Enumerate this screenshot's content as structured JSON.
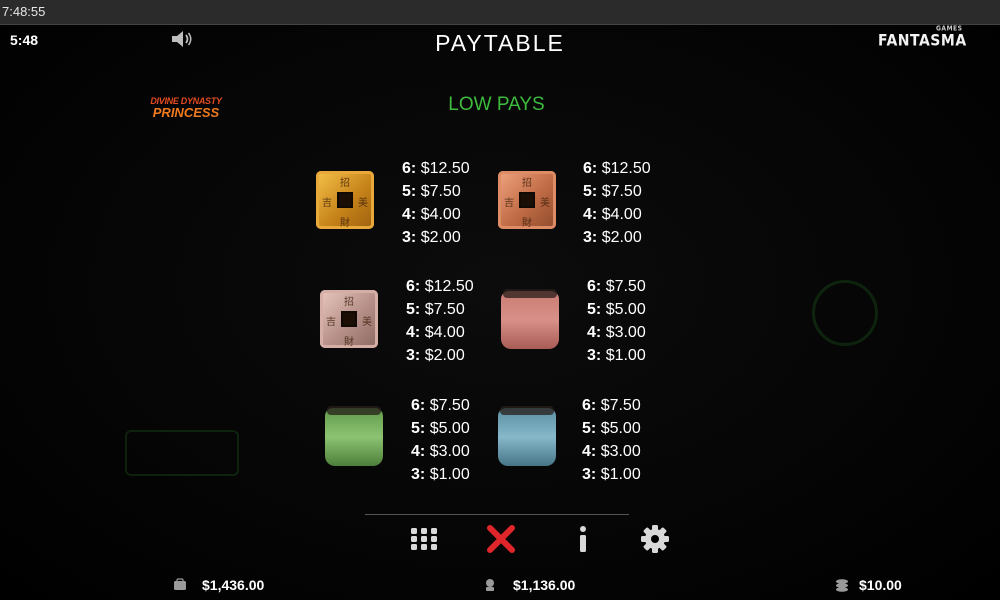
{
  "system_bar": {
    "clock": "7:48:55"
  },
  "header": {
    "game_time": "5:48",
    "title": "PAYTABLE",
    "brand": "FANTASMA",
    "brand_sub": "GAMES"
  },
  "game_logo": {
    "line1": "DIVINE DYNASTY",
    "line2": "PRINCESS"
  },
  "section_title": "LOW PAYS",
  "paytable": [
    {
      "symbol": "gold-coin-icon",
      "pays": [
        {
          "count": "6:",
          "amount": "$12.50"
        },
        {
          "count": "5:",
          "amount": "$7.50"
        },
        {
          "count": "4:",
          "amount": "$4.00"
        },
        {
          "count": "3:",
          "amount": "$2.00"
        }
      ]
    },
    {
      "symbol": "copper-coin-icon",
      "pays": [
        {
          "count": "6:",
          "amount": "$12.50"
        },
        {
          "count": "5:",
          "amount": "$7.50"
        },
        {
          "count": "4:",
          "amount": "$4.00"
        },
        {
          "count": "3:",
          "amount": "$2.00"
        }
      ]
    },
    {
      "symbol": "silver-coin-icon",
      "pays": [
        {
          "count": "6:",
          "amount": "$12.50"
        },
        {
          "count": "5:",
          "amount": "$7.50"
        },
        {
          "count": "4:",
          "amount": "$4.00"
        },
        {
          "count": "3:",
          "amount": "$2.00"
        }
      ]
    },
    {
      "symbol": "red-jar-icon",
      "pays": [
        {
          "count": "6:",
          "amount": "$7.50"
        },
        {
          "count": "5:",
          "amount": "$5.00"
        },
        {
          "count": "4:",
          "amount": "$3.00"
        },
        {
          "count": "3:",
          "amount": "$1.00"
        }
      ]
    },
    {
      "symbol": "green-jar-icon",
      "pays": [
        {
          "count": "6:",
          "amount": "$7.50"
        },
        {
          "count": "5:",
          "amount": "$5.00"
        },
        {
          "count": "4:",
          "amount": "$3.00"
        },
        {
          "count": "3:",
          "amount": "$1.00"
        }
      ]
    },
    {
      "symbol": "blue-jar-icon",
      "pays": [
        {
          "count": "6:",
          "amount": "$7.50"
        },
        {
          "count": "5:",
          "amount": "$5.00"
        },
        {
          "count": "4:",
          "amount": "$3.00"
        },
        {
          "count": "3:",
          "amount": "$1.00"
        }
      ]
    }
  ],
  "toolbar": {
    "menu_icon": "grid-menu-icon",
    "close_icon": "close-icon",
    "info_icon": "info-icon",
    "settings_icon": "gear-icon"
  },
  "footer": {
    "balance": "$1,436.00",
    "win": "$1,136.00",
    "bet": "$10.00"
  },
  "colors": {
    "section": "#3dbb3d",
    "close": "#e0262a",
    "background": "#000000"
  }
}
